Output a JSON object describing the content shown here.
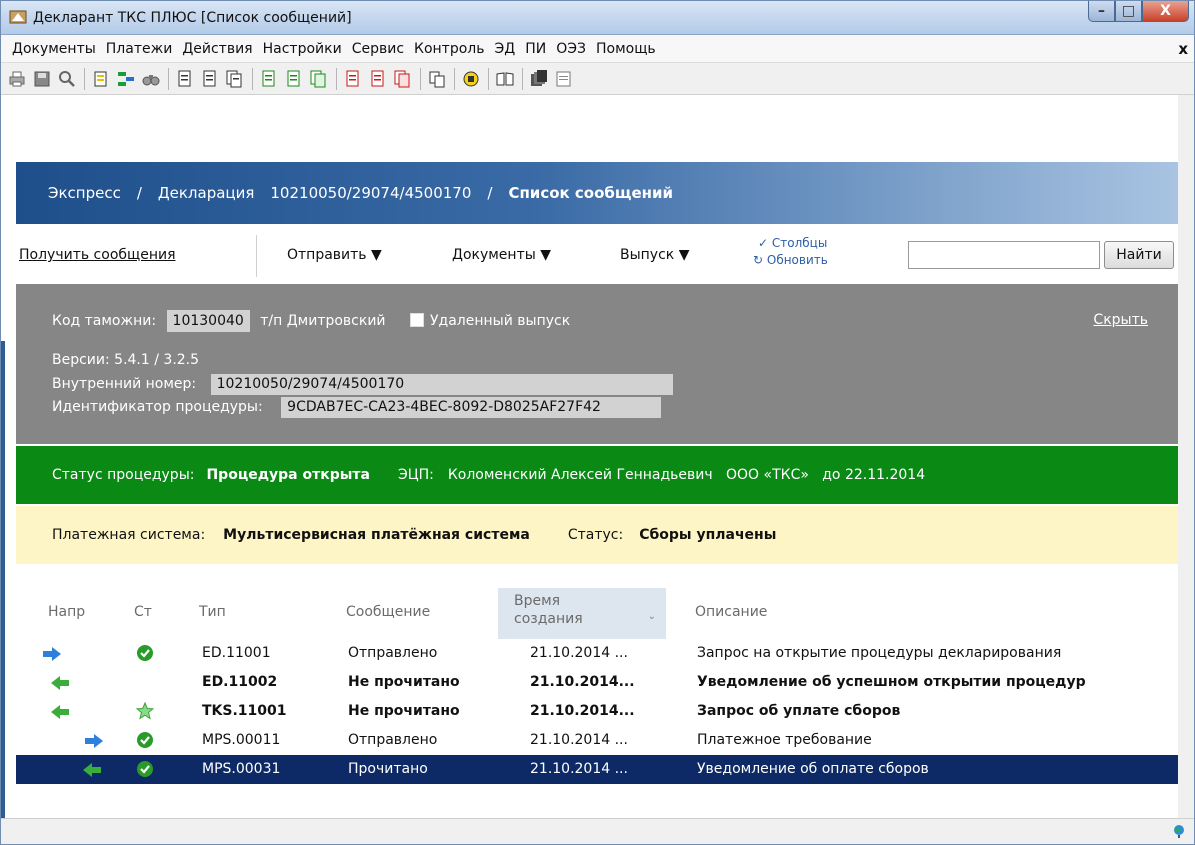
{
  "window": {
    "title": "Декларант ТКС ПЛЮС [Список сообщений]",
    "buttons": {
      "minimize": "–",
      "maximize": "□",
      "close": "X"
    }
  },
  "menu": {
    "items": [
      "Документы",
      "Платежи",
      "Действия",
      "Настройки",
      "Сервис",
      "Контроль",
      "ЭД",
      "ПИ",
      "ОЭЗ",
      "Помощь"
    ],
    "close": "x"
  },
  "toolbar": {
    "icons": [
      "printer-icon",
      "save-icon",
      "zoom-icon",
      "new-doc-icon",
      "tree-icon",
      "binoculars-icon",
      "doc-icon",
      "doc-icon",
      "docs-icon",
      "doc-green-icon",
      "doc-green-icon",
      "docs-green-icon",
      "doc-red-icon",
      "doc-red-icon",
      "docs-red-icon",
      "copy-icon",
      "hand-icon",
      "book-icon",
      "stack-icon",
      "window-icon"
    ]
  },
  "breadcrumb": {
    "part1": "Экспресс",
    "sep": "/",
    "part2": "Декларация",
    "part3": "10210050/29074/4500170",
    "current": "Список сообщений"
  },
  "actions": {
    "get_messages": "Получить сообщения",
    "send": "Отправить ▼",
    "documents": "Документы ▼",
    "release": "Выпуск ▼",
    "columns": "✓ Столбцы",
    "refresh": "↻ Обновить",
    "search_value": "",
    "search_button": "Найти"
  },
  "info": {
    "customs_label": "Код таможни:",
    "customs_code": "10130040",
    "customs_post": "т/п Дмитровский",
    "remote_release": "Удаленный выпуск",
    "hide": "Скрыть",
    "versions": "Версии:  5.4.1  /  3.2.5",
    "internal_label": "Внутренний номер:",
    "internal_value": "10210050/29074/4500170",
    "procid_label": "Идентификатор процедуры:",
    "procid_value": "9CDAB7EC-CA23-4BEC-8092-D8025AF27F42"
  },
  "status": {
    "label": "Статус процедуры:",
    "value": "Процедура открыта",
    "sign_label": "ЭЦП:",
    "sign_value": "Коломенский Алексей Геннадьевич   ООО «ТКС»   до 22.11.2014"
  },
  "payment": {
    "system_label": "Платежная система:",
    "system_value": "Мультисервисная платёжная система",
    "status_label": "Статус:",
    "status_value": "Сборы уплачены"
  },
  "table": {
    "columns": {
      "dir": "Напр",
      "st": "Ст",
      "type": "Тип",
      "msg": "Сообщение",
      "time_l1": "Время",
      "time_l2": "создания",
      "desc": "Описание"
    },
    "rows": [
      {
        "dir": "out",
        "status": "ok",
        "type": "ED.11001",
        "msg": "Отправлено",
        "time": "21.10.2014 ...",
        "desc": "Запрос на открытие процедуры декларирования"
      },
      {
        "dir": "in",
        "status": "",
        "type": "ED.11002",
        "msg": "Не прочитано",
        "time": "21.10.2014...",
        "desc": "Уведомление об успешном открытии процедур"
      },
      {
        "dir": "in",
        "status": "star",
        "type": "TKS.11001",
        "msg": "Не прочитано",
        "time": "21.10.2014...",
        "desc": "Запрос об уплате сборов"
      },
      {
        "dir": "out",
        "status": "ok",
        "type": "MPS.00011",
        "msg": "Отправлено",
        "time": "21.10.2014 ...",
        "desc": "Платежное требование"
      },
      {
        "dir": "in",
        "status": "ok",
        "type": "MPS.00031",
        "msg": "Прочитано",
        "time": "21.10.2014 ...",
        "desc": "Уведомление об оплате сборов"
      }
    ]
  },
  "colors": {
    "selected_row": "#0e2a66",
    "status_green": "#0a8a14",
    "payment_yellow": "#fdf5c6",
    "gray_panel": "#868686"
  }
}
